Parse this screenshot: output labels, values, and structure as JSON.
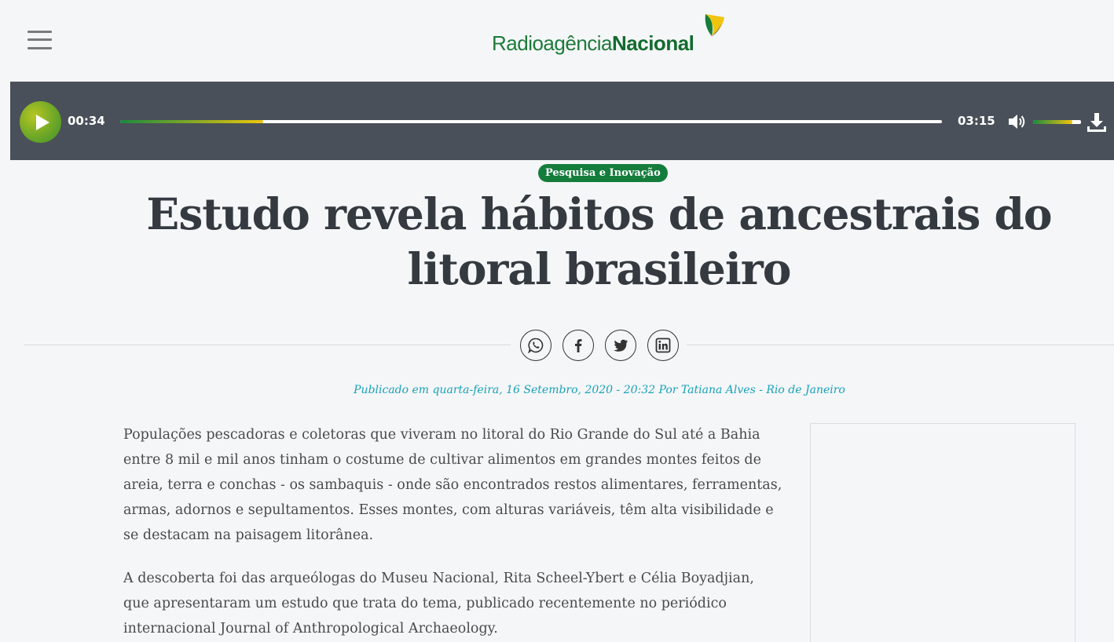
{
  "header": {
    "menu_icon": "hamburger-menu-icon",
    "logo": {
      "part1": "Radioagência",
      "part2": "Nacional",
      "colors": {
        "green": "#157d3c",
        "yellow": "#f1c40f",
        "blue": "#1e4fa0"
      }
    }
  },
  "player": {
    "current_time": "00:34",
    "duration": "03:15",
    "progress_fraction": 0.174,
    "volume_fraction": 0.82,
    "icons": {
      "play": "play-icon",
      "volume": "volume-icon",
      "download": "download-icon"
    },
    "colors": {
      "bar": "#4a5059",
      "accent_start": "#1b8a3e",
      "accent_end": "#f1c40f"
    }
  },
  "article": {
    "category": "Pesquisa e Inovação",
    "title": "Estudo revela hábitos de ancestrais do litoral brasileiro",
    "byline": "Publicado em quarta-feira, 16 Setembro, 2020 - 20:32 Por Tatiana Alves - Rio de Janeiro",
    "paragraphs": [
      "Populações pescadoras e coletoras que viveram no litoral do Rio Grande do Sul até a Bahia entre 8 mil  e mil anos tinham o costume de cultivar alimentos em grandes montes feitos de areia, terra e conchas - os sambaquis - onde são encontrados restos alimentares, ferramentas, armas, adornos e sepultamentos. Esses montes, com alturas variáveis, têm alta visibilidade e se destacam na paisagem litorânea.",
      "A descoberta foi das arqueólogas do Museu Nacional, Rita Scheel-Ybert e Célia Boyadjian, que apresentaram um estudo que trata do tema, publicado recentemente no periódico internacional Journal of Anthropological Archaeology."
    ]
  },
  "share": {
    "buttons": [
      "whatsapp-icon",
      "facebook-icon",
      "twitter-icon",
      "linkedin-icon"
    ]
  }
}
